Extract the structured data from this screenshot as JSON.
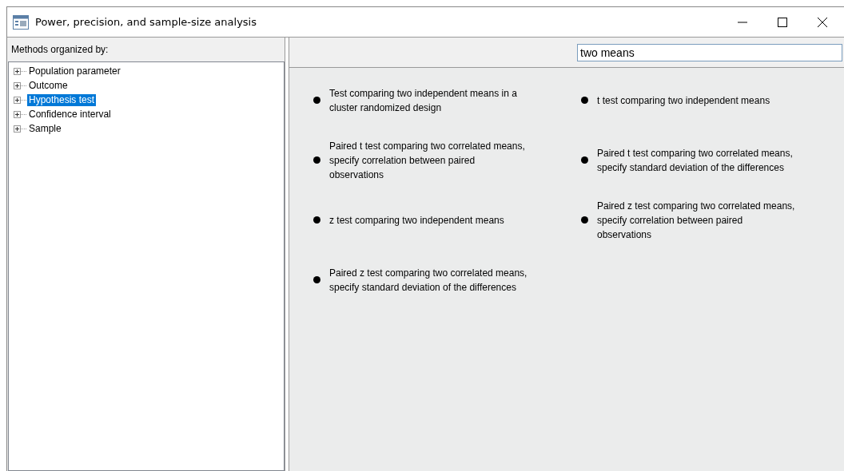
{
  "window": {
    "title": "Power, precision, and sample-size analysis"
  },
  "sidebar": {
    "header": "Methods organized by:",
    "items": [
      {
        "label": "Population parameter",
        "expanded": false,
        "selected": false
      },
      {
        "label": "Outcome",
        "expanded": false,
        "selected": false
      },
      {
        "label": "Hypothesis test",
        "expanded": false,
        "selected": true
      },
      {
        "label": "Confidence interval",
        "expanded": false,
        "selected": false
      },
      {
        "label": "Sample",
        "expanded": false,
        "selected": false
      }
    ]
  },
  "search": {
    "value": "two means"
  },
  "results": [
    {
      "label": "Test comparing two independent means in a cluster randomized design"
    },
    {
      "label": "Paired t test comparing two correlated means, specify correlation between paired observations"
    },
    {
      "label": "z test comparing two independent means"
    },
    {
      "label": "Paired z test comparing two correlated means, specify standard deviation of the differences"
    },
    {
      "label": "t test comparing two independent means"
    },
    {
      "label": "Paired t test comparing two correlated means, specify standard deviation of the differences"
    },
    {
      "label": "Paired z test comparing two correlated means, specify correlation between paired observations"
    }
  ]
}
